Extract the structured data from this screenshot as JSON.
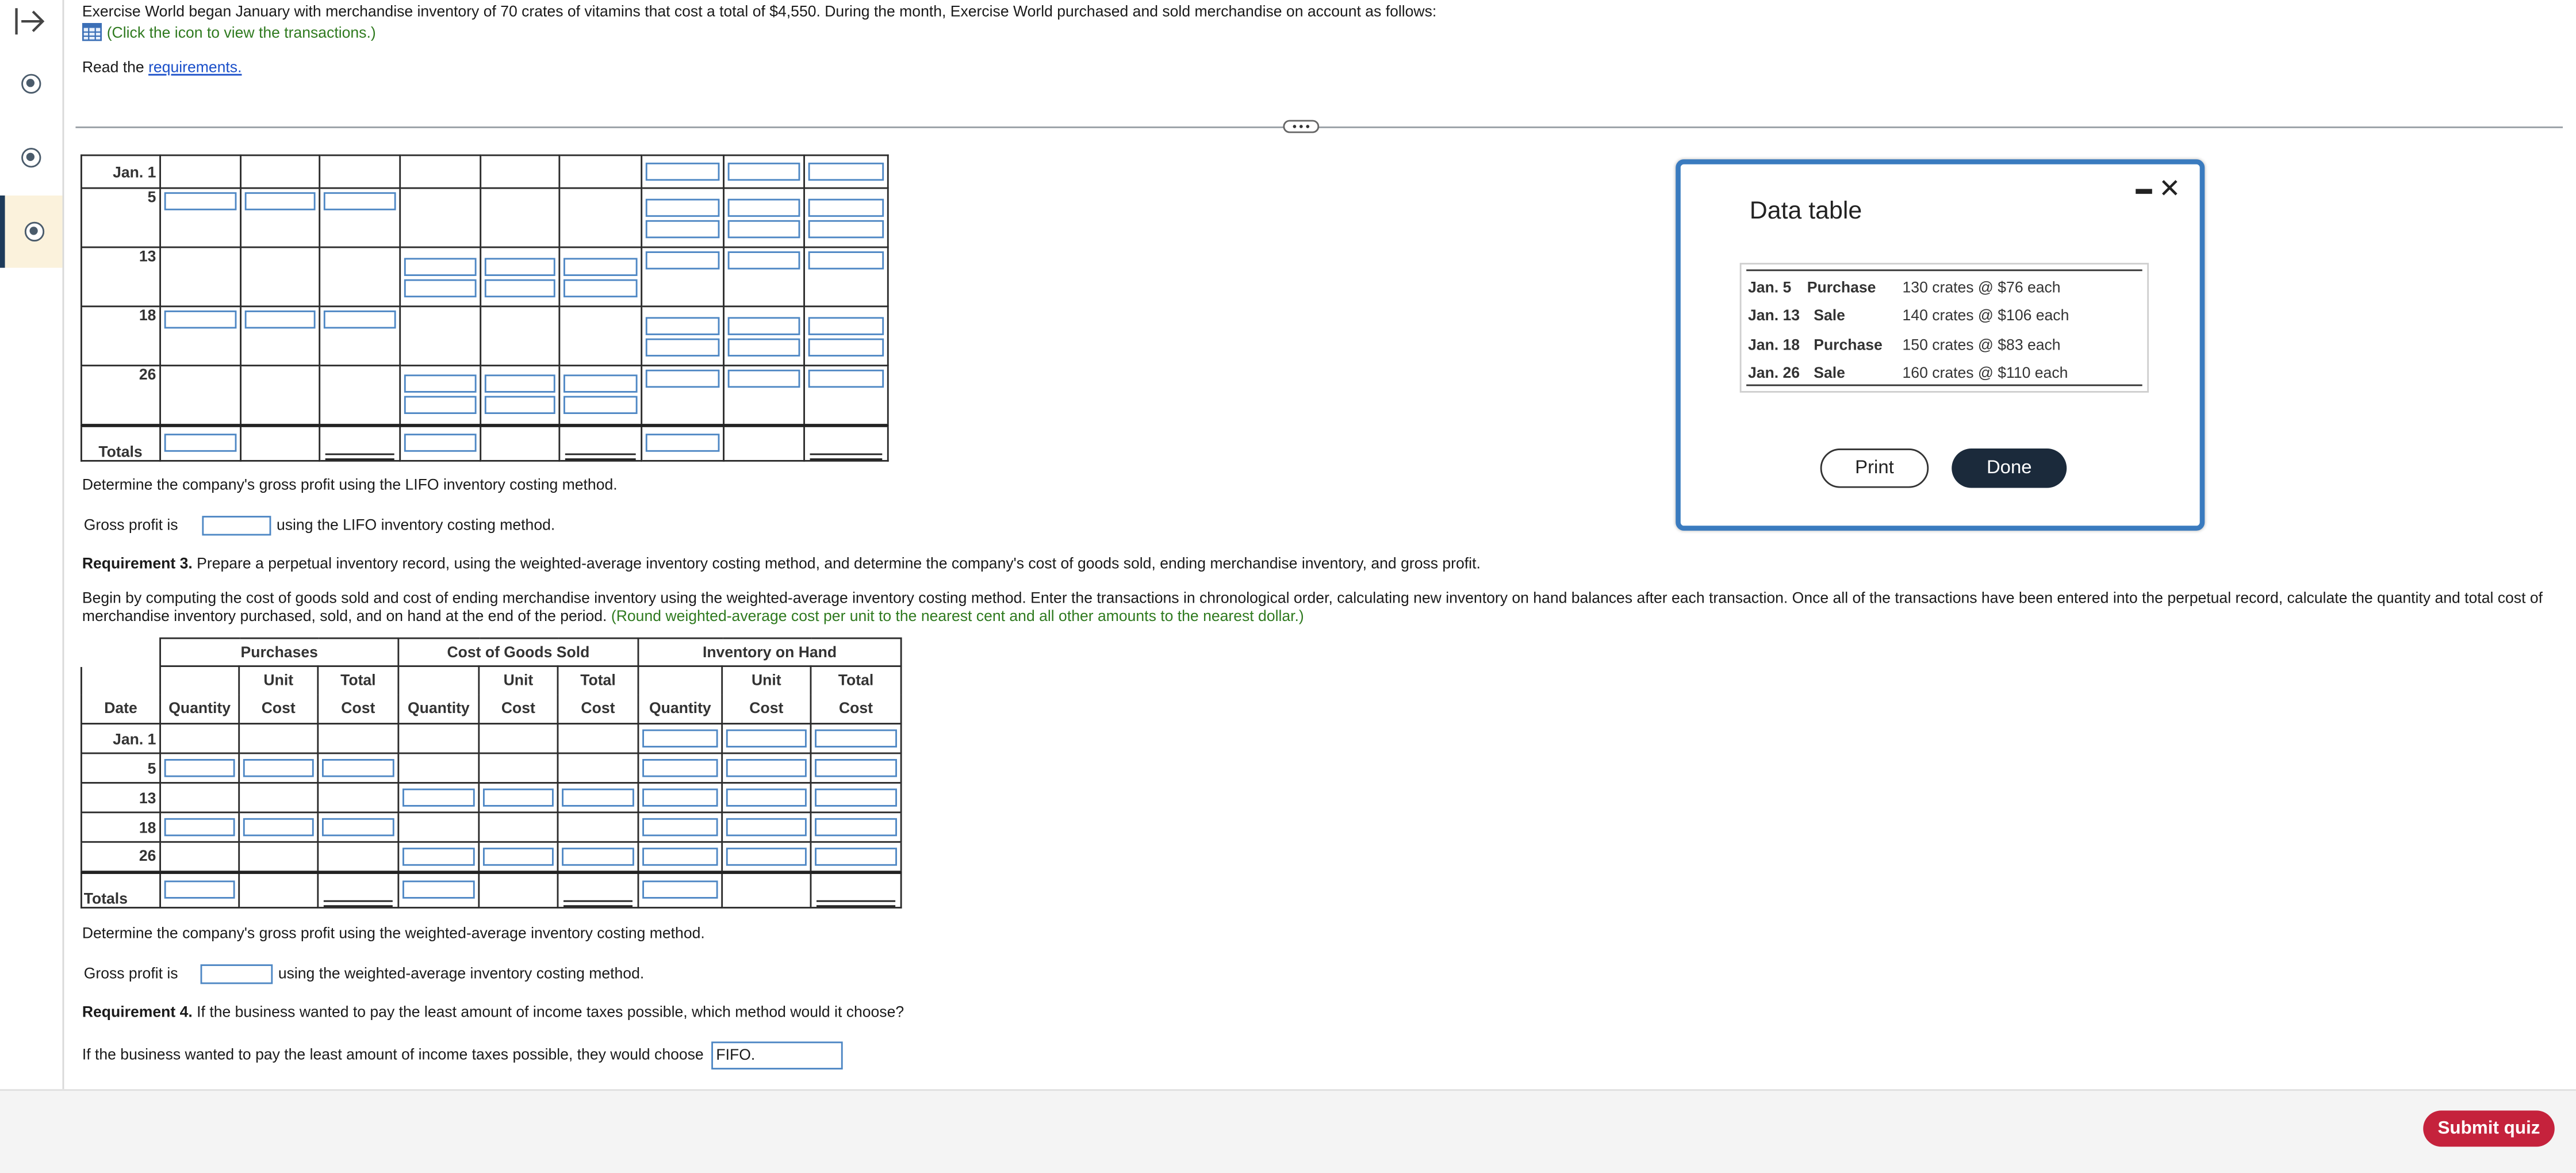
{
  "intro": {
    "line1": "Exercise World began January with merchandise inventory of 70 crates of vitamins that cost a total of $4,550. During the month, Exercise World purchased and sold merchandise on account as follows:",
    "transactions_hint": "(Click the icon to view the transactions.)",
    "read_prefix": "Read the",
    "requirements_link": "requirements."
  },
  "lifo_table": {
    "rows": [
      {
        "date": "Jan. 1"
      },
      {
        "date": "5"
      },
      {
        "date": "13"
      },
      {
        "date": "18"
      },
      {
        "date": "26"
      }
    ],
    "totals_label": "Totals"
  },
  "lifo": {
    "determine": "Determine the company's gross profit using the LIFO inventory costing method.",
    "gp_label": "Gross profit is",
    "gp_suffix": "using the LIFO inventory costing method."
  },
  "req3": {
    "bold": "Requirement 3.",
    "text": "Prepare a perpetual inventory record, using the weighted-average inventory costing method, and determine the company's cost of goods sold, ending merchandise inventory, and gross profit.",
    "begin_line1": "Begin by computing the cost of goods sold and cost of ending merchandise inventory using the weighted-average inventory costing method. Enter the transactions in chronological order, calculating new inventory on hand balances after each transaction. Once all of the transactions have been entered into the perpetual record, calculate the quantity and total cost of",
    "begin_line2": "merchandise inventory purchased, sold, and on hand at the end of the period.",
    "round_note": "(Round weighted-average cost per unit to the nearest cent and all other amounts to the nearest dollar.)"
  },
  "wa_table": {
    "groups": [
      "Purchases",
      "Cost of Goods Sold",
      "Inventory on Hand"
    ],
    "col_top": [
      "",
      "Unit",
      "Total"
    ],
    "col_bottom": [
      "Quantity",
      "Cost",
      "Cost"
    ],
    "date_header": "Date",
    "rows": [
      {
        "date": "Jan. 1"
      },
      {
        "date": "5"
      },
      {
        "date": "13"
      },
      {
        "date": "18"
      },
      {
        "date": "26"
      }
    ],
    "totals_label": "Totals"
  },
  "wa": {
    "determine": "Determine the company's gross profit using the weighted-average inventory costing method.",
    "gp_label": "Gross profit is",
    "gp_suffix": "using the weighted-average inventory costing method."
  },
  "req4": {
    "bold": "Requirement 4.",
    "text": "If the business wanted to pay the least amount of income taxes possible, which method would it choose?",
    "answer_prefix": "If the business wanted to pay the least amount of income taxes possible, they would choose",
    "answer_value": "FIFO."
  },
  "dialog": {
    "title": "Data table",
    "rows": [
      {
        "date": "Jan. 5",
        "type": "Purchase",
        "detail": "130 crates @ $76 each"
      },
      {
        "date": "Jan. 13",
        "type": "Sale",
        "detail": "140 crates @ $106 each"
      },
      {
        "date": "Jan. 18",
        "type": "Purchase",
        "detail": "150 crates @ $83 each"
      },
      {
        "date": "Jan. 26",
        "type": "Sale",
        "detail": "160 crates @ $110 each"
      }
    ],
    "print": "Print",
    "done": "Done"
  },
  "footer": {
    "submit": "Submit quiz"
  },
  "colors": {
    "accent": "#3a7bbf",
    "input_border": "#4e87c4",
    "submit": "#c5223c",
    "done": "#1b2a3b",
    "hint_green": "#2f7a1f"
  }
}
